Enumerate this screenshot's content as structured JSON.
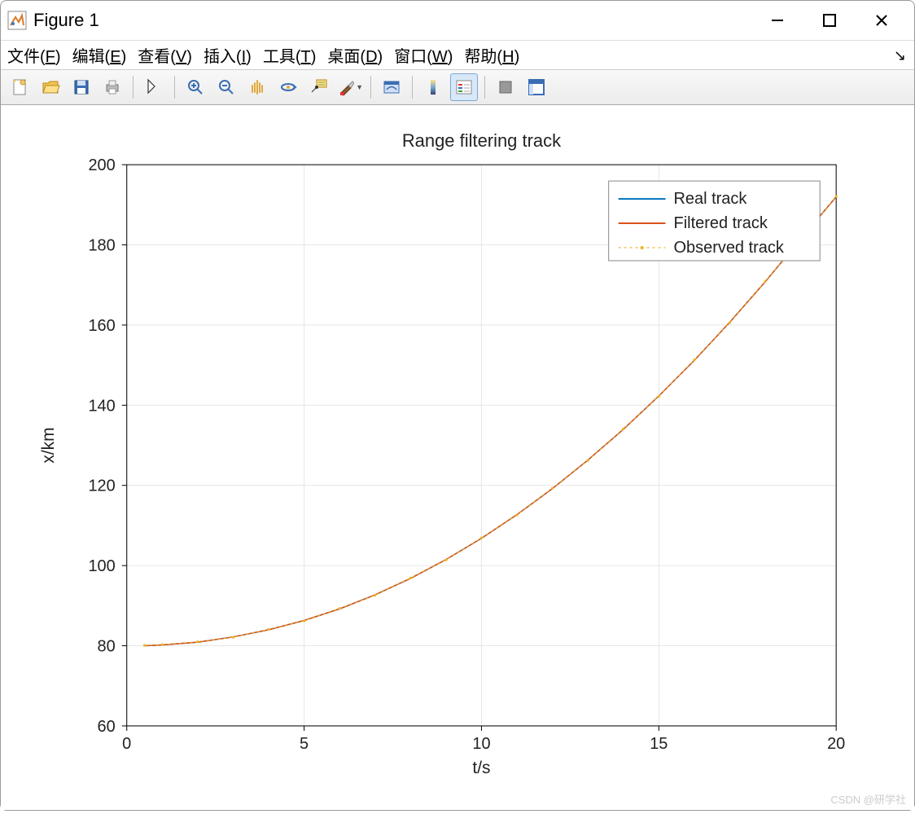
{
  "window": {
    "title": "Figure 1"
  },
  "menubar": {
    "items": [
      {
        "pre": "文件(",
        "u": "F",
        "post": ")"
      },
      {
        "pre": "编辑(",
        "u": "E",
        "post": ")"
      },
      {
        "pre": "查看(",
        "u": "V",
        "post": ")"
      },
      {
        "pre": "插入(",
        "u": "I",
        "post": ")"
      },
      {
        "pre": "工具(",
        "u": "T",
        "post": ")"
      },
      {
        "pre": "桌面(",
        "u": "D",
        "post": ")"
      },
      {
        "pre": "窗口(",
        "u": "W",
        "post": ")"
      },
      {
        "pre": "帮助(",
        "u": "H",
        "post": ")"
      }
    ]
  },
  "watermark": "CSDN @研学社",
  "chart_data": {
    "type": "line",
    "title": "Range filtering track",
    "xlabel": "t/s",
    "ylabel": "x/km",
    "xlim": [
      0,
      20
    ],
    "ylim": [
      60,
      200
    ],
    "xticks": [
      0,
      5,
      10,
      15,
      20
    ],
    "yticks": [
      60,
      80,
      100,
      120,
      140,
      160,
      180,
      200
    ],
    "legend": [
      "Real track",
      "Filtered track",
      "Observed track"
    ],
    "legend_position": "upper-right-inside",
    "grid": true,
    "colors": {
      "Real track": "#0072BD",
      "Filtered track": "#D95319",
      "Observed track": "#EDB120"
    },
    "x": [
      0.5,
      1,
      2,
      3,
      4,
      5,
      6,
      7,
      8,
      9,
      10,
      11,
      12,
      13,
      14,
      15,
      16,
      17,
      18,
      19,
      20
    ],
    "series": [
      {
        "name": "Real track",
        "values": [
          80.0,
          80.2,
          80.9,
          82.2,
          84.0,
          86.3,
          89.2,
          92.7,
          96.8,
          101.5,
          106.8,
          112.7,
          119.2,
          126.3,
          134.0,
          142.3,
          151.2,
          160.7,
          170.8,
          181.5,
          192.0
        ]
      },
      {
        "name": "Filtered track",
        "values": [
          80.0,
          80.2,
          80.9,
          82.2,
          84.0,
          86.3,
          89.2,
          92.7,
          96.8,
          101.5,
          106.8,
          112.7,
          119.2,
          126.3,
          134.0,
          142.3,
          151.2,
          160.7,
          170.8,
          181.5,
          192.0
        ]
      },
      {
        "name": "Observed track",
        "style": "dotted-marker",
        "values": [
          80.1,
          80.3,
          81.0,
          82.1,
          84.1,
          86.2,
          89.3,
          92.6,
          96.9,
          101.4,
          106.9,
          112.6,
          119.3,
          126.2,
          134.1,
          142.2,
          151.3,
          160.6,
          170.9,
          181.4,
          192.1
        ]
      }
    ]
  }
}
